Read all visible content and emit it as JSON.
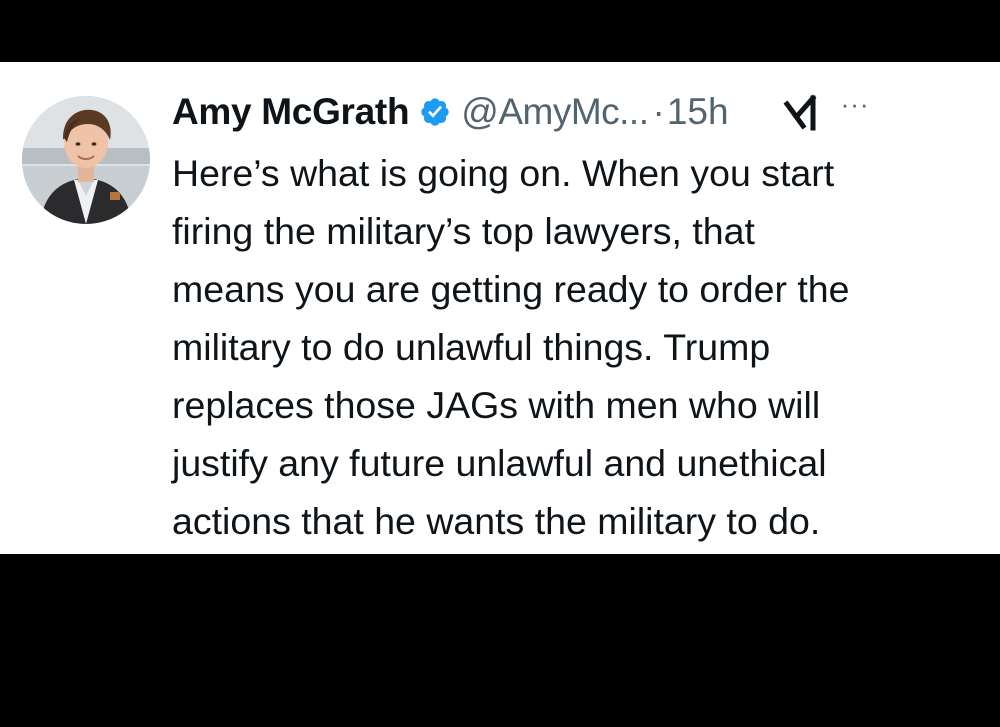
{
  "tweet": {
    "author": {
      "display_name": "Amy McGrath",
      "handle": "@AmyMc...",
      "verified": true,
      "avatar_icon": "profile-photo"
    },
    "separator": "·",
    "timestamp": "15h",
    "grok_icon": "grok-icon",
    "more_label": "···",
    "text_lines": [
      "Here’s what is going on. When you start",
      "firing the military’s top lawyers, that",
      "means you are getting ready to order the",
      "military to do unlawful things. Trump",
      "replaces those JAGs with men who will",
      "justify any future unlawful and unethical",
      "actions that he wants the military to do."
    ]
  },
  "colors": {
    "background": "#000000",
    "card": "#ffffff",
    "text_primary": "#0f1419",
    "text_secondary": "#536471",
    "verified_blue": "#1d9bf0"
  }
}
